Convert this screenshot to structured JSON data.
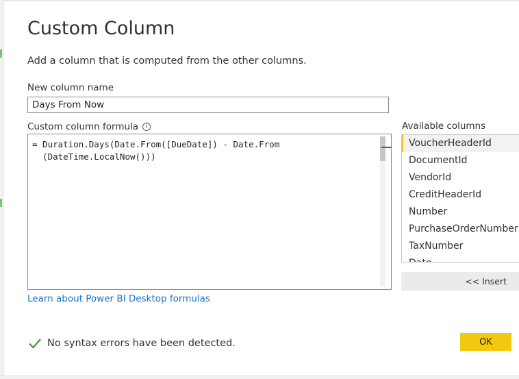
{
  "dialog": {
    "title": "Custom Column",
    "subtitle": "Add a column that is computed from the other columns."
  },
  "column_name": {
    "label": "New column name",
    "value": "Days From Now"
  },
  "formula": {
    "label": "Custom column formula",
    "info_icon": "info-icon",
    "line1": "= Duration.Days(Date.From([DueDate]) - Date.From",
    "line2": "  (DateTime.LocalNow()))"
  },
  "available_columns": {
    "label": "Available columns",
    "items": [
      "VoucherHeaderId",
      "DocumentId",
      "VendorId",
      "CreditHeaderId",
      "Number",
      "PurchaseOrderNumber",
      "TaxNumber",
      "Date"
    ],
    "selected": "VoucherHeaderId"
  },
  "insert_button": "<< Insert",
  "learn_link": "Learn about Power BI Desktop formulas",
  "status": {
    "icon": "checkmark-icon",
    "text": "No syntax errors have been detected.",
    "color": "#3a9a3a"
  },
  "ok_button": "OK",
  "colors": {
    "accent": "#f2c811",
    "link": "#1a73c8"
  }
}
